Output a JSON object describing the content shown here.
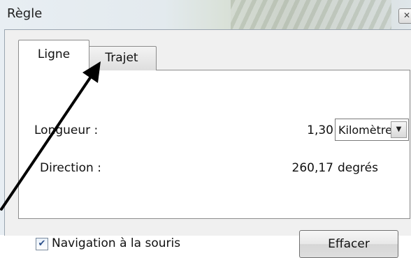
{
  "window": {
    "title": "Règle",
    "close_icon": "close-icon"
  },
  "tabs": [
    {
      "label": "Ligne",
      "active": true
    },
    {
      "label": "Trajet",
      "active": false
    }
  ],
  "measure": {
    "length_label": "Longueur :",
    "length_value": "1,30",
    "unit_selected": "Kilomètres",
    "direction_label": "Direction :",
    "direction_value": "260,17",
    "direction_unit": "degrés"
  },
  "footer": {
    "mouse_nav_label": "Navigation à la souris",
    "mouse_nav_checked": true,
    "clear_label": "Effacer"
  },
  "annotation": {
    "icon": "pointer-arrow-icon",
    "color": "#000000"
  }
}
